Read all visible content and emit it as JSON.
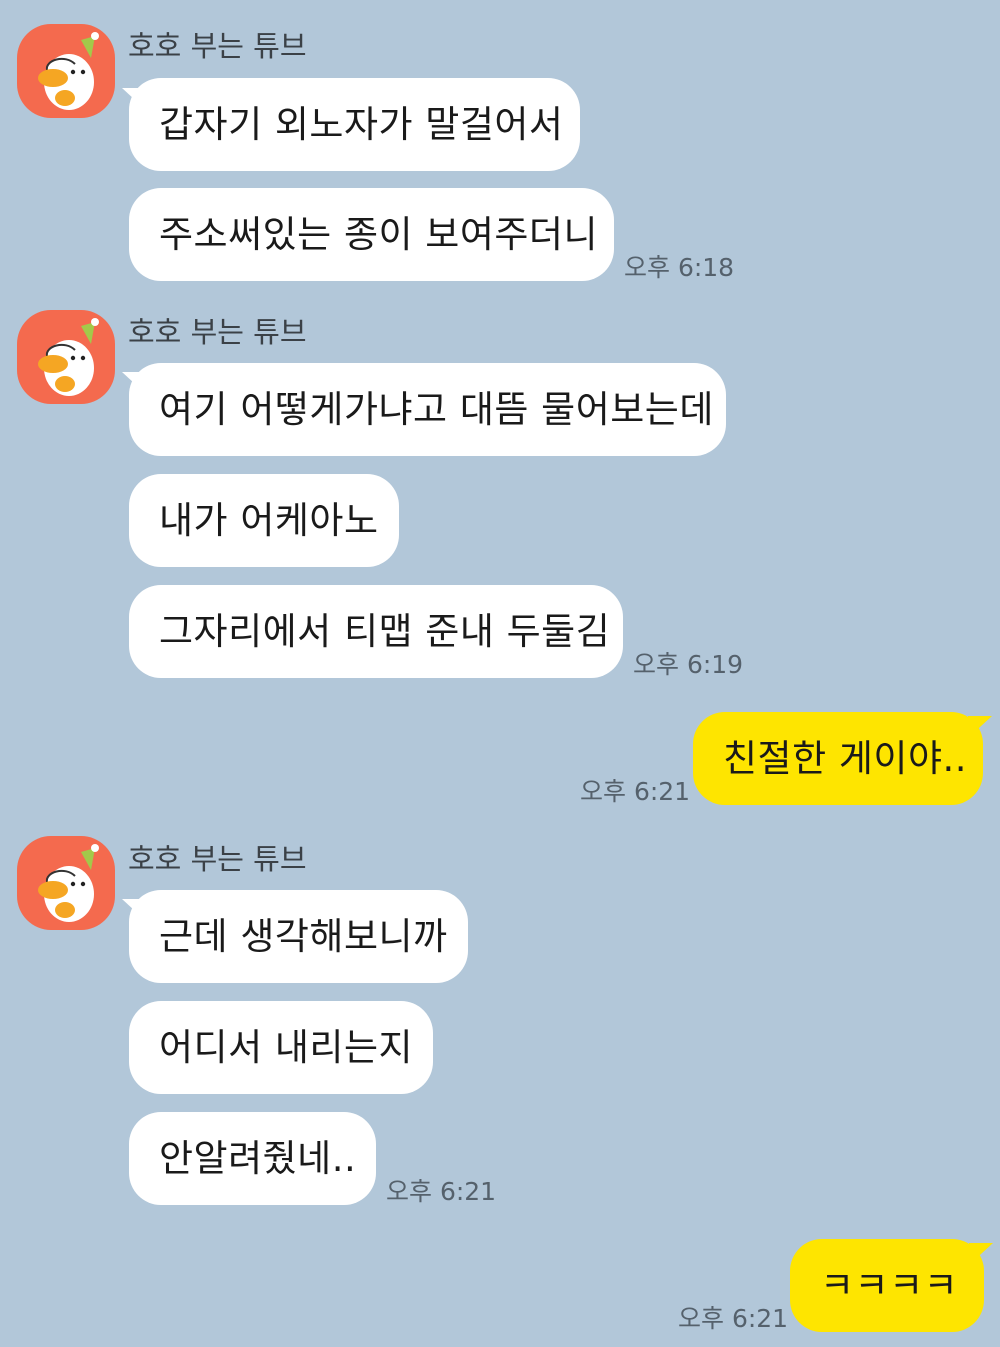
{
  "chat": {
    "groups": [
      {
        "sender": "호호 부는 튜브",
        "messages": [
          "갑자기 외노자가 말걸어서",
          "주소써있는 종이 보여주더니"
        ],
        "time": "오후 6:18"
      },
      {
        "sender": "호호 부는 튜브",
        "messages": [
          "여기 어떻게가냐고 대뜸 물어보는데",
          "내가 어케아노",
          "그자리에서 티맵 준내 두둘김"
        ],
        "time": "오후 6:19"
      },
      {
        "mine": true,
        "messages": [
          "친절한 게이야.."
        ],
        "time": "오후 6:21"
      },
      {
        "sender": "호호 부는 튜브",
        "messages": [
          "근데 생각해보니까",
          "어디서 내리는지",
          "안알려줬네.."
        ],
        "time": "오후 6:21"
      },
      {
        "mine": true,
        "messages": [
          "ㅋㅋㅋㅋ"
        ],
        "time": "오후 6:21"
      }
    ]
  },
  "colors": {
    "background": "#b2c7d9",
    "incoming_bubble": "#ffffff",
    "outgoing_bubble": "#fee500",
    "avatar_bg": "#f46a4e"
  },
  "icons": {
    "avatar": "tube-duck-character-icon"
  }
}
